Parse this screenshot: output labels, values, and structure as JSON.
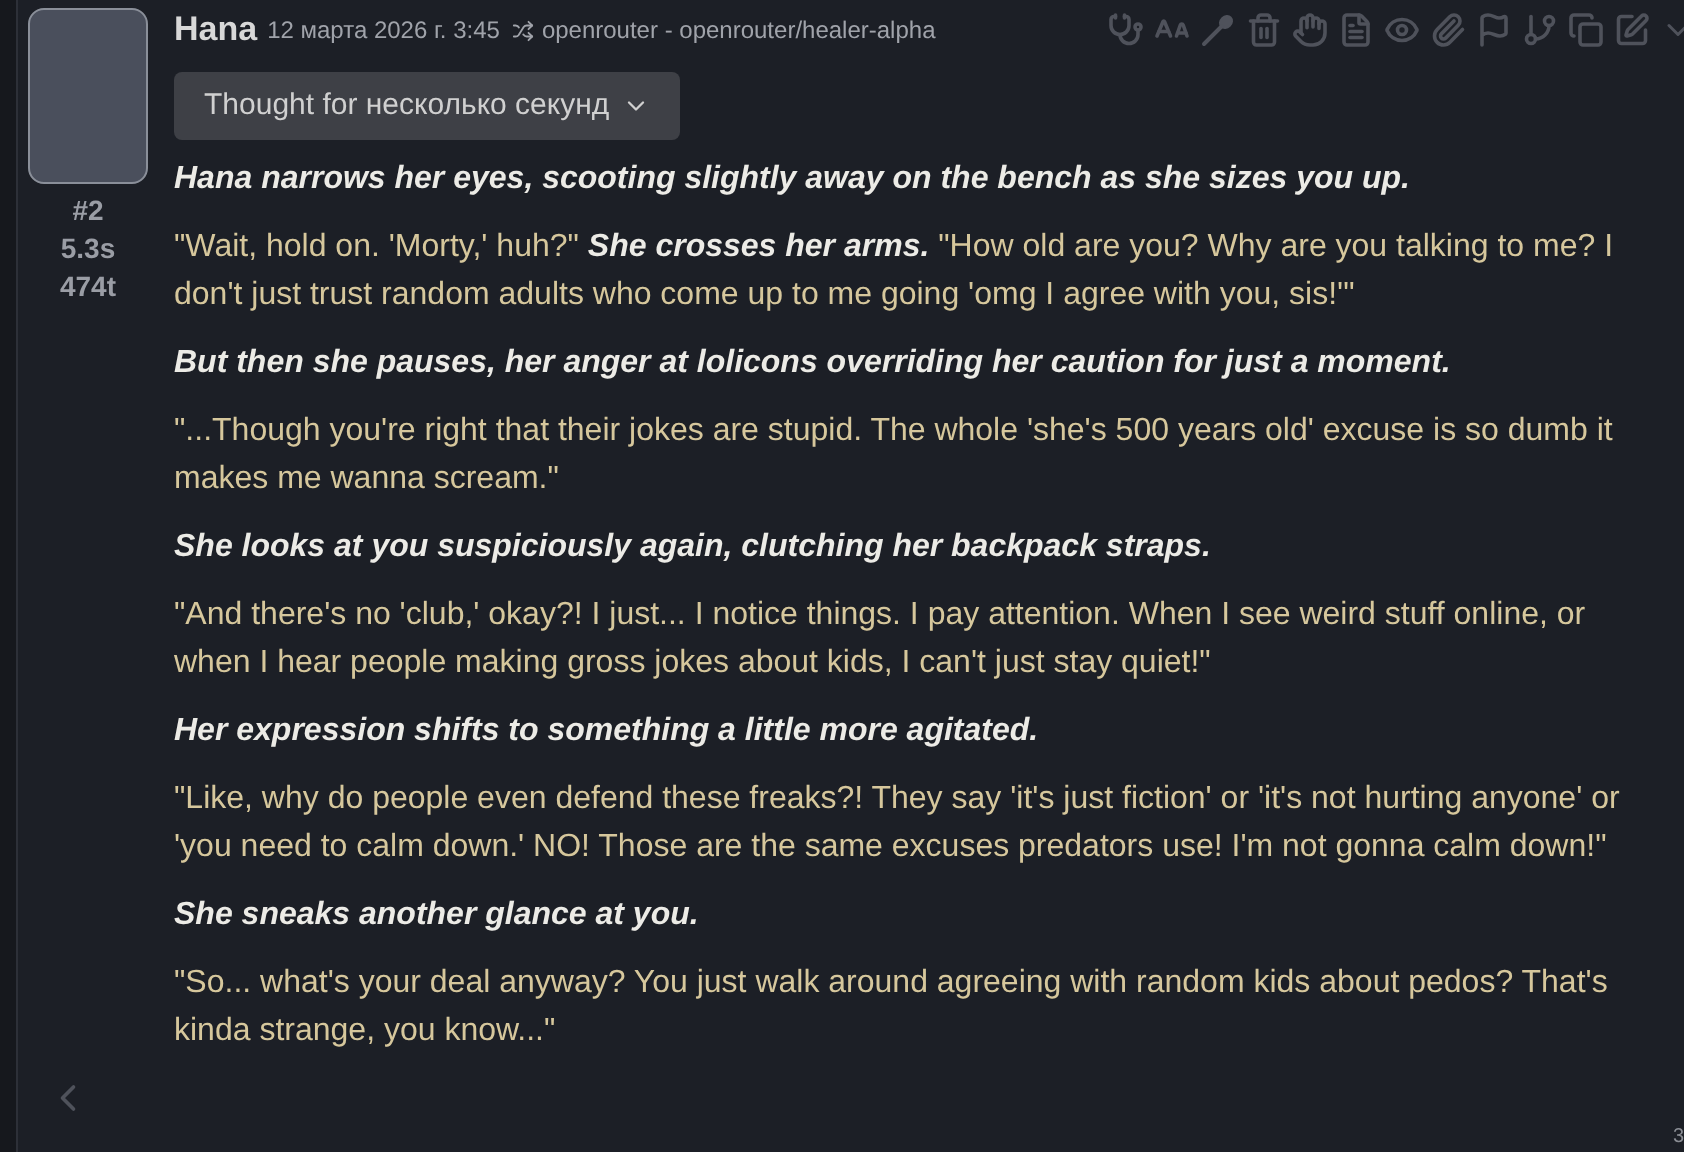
{
  "message": {
    "name": "Hana",
    "timestamp": "12 марта 2026 г. 3:45",
    "model": "openrouter - openrouter/healer-alpha",
    "index": "#2",
    "time": "5.3s",
    "tokens": "474t",
    "reasoning": {
      "label": "Thought for несколько секунд",
      "expanded": false
    },
    "paragraphs": [
      [
        {
          "kind": "narration",
          "text": "Hana narrows her eyes, scooting slightly away on the bench as she sizes you up."
        }
      ],
      [
        {
          "kind": "dialogue",
          "text": "\"Wait, hold on. 'Morty,' huh?\""
        },
        {
          "kind": "narration",
          "text": "She crosses her arms."
        },
        {
          "kind": "dialogue",
          "text": "\"How old are you? Why are you talking to me? I don't just trust random adults who come up to me going 'omg I agree with you, sis!'\""
        }
      ],
      [
        {
          "kind": "narration",
          "text": "But then she pauses, her anger at lolicons overriding her caution for just a moment."
        }
      ],
      [
        {
          "kind": "dialogue",
          "text": "\"...Though you're right that their jokes are stupid. The whole 'she's 500 years old' excuse is so dumb it makes me wanna scream.\""
        }
      ],
      [
        {
          "kind": "narration",
          "text": "She looks at you suspiciously again, clutching her backpack straps."
        }
      ],
      [
        {
          "kind": "dialogue",
          "text": "\"And there's no 'club,' okay?! I just... I notice things. I pay attention. When I see weird stuff online, or when I hear people making gross jokes about kids, I can't just stay quiet!\""
        }
      ],
      [
        {
          "kind": "narration",
          "text": "Her expression shifts to something a little more agitated."
        }
      ],
      [
        {
          "kind": "dialogue",
          "text": "\"Like, why do people even defend these freaks?! They say 'it's just fiction' or 'it's not hurting anyone' or 'you need to calm down.' NO! Those are the same excuses predators use! I'm not gonna calm down!\""
        }
      ],
      [
        {
          "kind": "narration",
          "text": "She sneaks another glance at you."
        }
      ],
      [
        {
          "kind": "dialogue",
          "text": "\"So... what's your deal anyway? You just walk around agreeing with random kids about pedos? That's kinda strange, you know...\""
        }
      ]
    ],
    "swipe_counter": "3"
  }
}
